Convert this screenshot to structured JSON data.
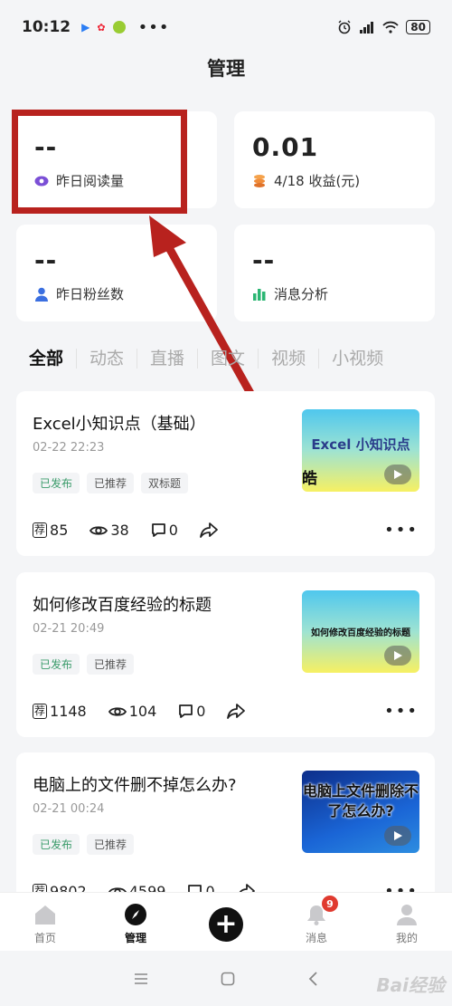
{
  "status_bar": {
    "time": "10:12",
    "more": "•••",
    "battery": "80"
  },
  "header": {
    "title": "管理"
  },
  "stats": [
    {
      "value": "--",
      "label": "昨日阅读量",
      "icon": "eye-icon",
      "color": "#7b4fd6"
    },
    {
      "value": "0.01",
      "label": "4/18 收益(元)",
      "icon": "coin-icon",
      "color": "#f08c3a"
    },
    {
      "value": "--",
      "label": "昨日粉丝数",
      "icon": "person-icon",
      "color": "#3b6fe0"
    },
    {
      "value": "--",
      "label": "消息分析",
      "icon": "bar-chart-icon",
      "color": "#2bb673"
    }
  ],
  "tabs": [
    "全部",
    "动态",
    "直播",
    "图文",
    "视频",
    "小视频"
  ],
  "articles": [
    {
      "title": "Excel小知识点（基础）",
      "date": "02-22 22:23",
      "tags": [
        "已发布",
        "已推荐",
        "双标题"
      ],
      "thumb_text": "Excel 小知识点",
      "thumb_side": "皓",
      "recommend": "85",
      "views": "38",
      "comments": "0"
    },
    {
      "title": "如何修改百度经验的标题",
      "date": "02-21 20:49",
      "tags": [
        "已发布",
        "已推荐"
      ],
      "thumb_text": "如何修改百度经验的标题",
      "recommend": "1148",
      "views": "104",
      "comments": "0"
    },
    {
      "title": "电脑上的文件删不掉怎么办?",
      "date": "02-21 00:24",
      "tags": [
        "已发布",
        "已推荐"
      ],
      "thumb_text": "电脑上文件删除不了怎么办?",
      "recommend": "9802",
      "views": "4599",
      "comments": "0"
    }
  ],
  "recommend_glyph": "荐",
  "bottom_nav": [
    {
      "label": "首页",
      "icon": "home-icon"
    },
    {
      "label": "管理",
      "icon": "compass-icon"
    },
    {
      "label": "",
      "icon": "plus-icon"
    },
    {
      "label": "消息",
      "icon": "bell-icon",
      "badge": "9"
    },
    {
      "label": "我的",
      "icon": "user-icon"
    }
  ],
  "watermark": "Bai经验"
}
